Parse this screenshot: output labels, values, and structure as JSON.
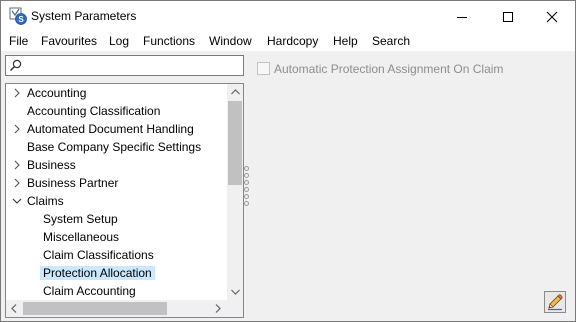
{
  "window": {
    "title": "System Parameters",
    "controls": {
      "minimize_icon": "minimize-icon",
      "maximize_icon": "maximize-icon",
      "close_icon": "close-icon"
    }
  },
  "menu": [
    "File",
    "Favourites",
    "Log",
    "Functions",
    "Window",
    "Hardcopy",
    "Help",
    "Search"
  ],
  "search": {
    "placeholder": "",
    "value": "",
    "icon": "search-icon"
  },
  "tree": {
    "items": [
      {
        "label": "Accounting",
        "level": 0,
        "state": "collapsed"
      },
      {
        "label": "Accounting Classification",
        "level": 0,
        "state": "none"
      },
      {
        "label": "Automated Document Handling",
        "level": 0,
        "state": "collapsed"
      },
      {
        "label": "Base Company Specific Settings",
        "level": 0,
        "state": "none"
      },
      {
        "label": "Business",
        "level": 0,
        "state": "collapsed"
      },
      {
        "label": "Business Partner",
        "level": 0,
        "state": "collapsed"
      },
      {
        "label": "Claims",
        "level": 0,
        "state": "expanded"
      },
      {
        "label": "System Setup",
        "level": 1,
        "state": "none"
      },
      {
        "label": "Miscellaneous",
        "level": 1,
        "state": "none"
      },
      {
        "label": "Claim Classifications",
        "level": 1,
        "state": "none"
      },
      {
        "label": "Protection Allocation",
        "level": 1,
        "state": "none",
        "selected": true
      },
      {
        "label": "Claim Accounting",
        "level": 1,
        "state": "none"
      }
    ]
  },
  "detail": {
    "checkbox_label": "Automatic Protection Assignment On Claim",
    "checkbox_checked": false,
    "checkbox_enabled": false
  },
  "edit_button_icon": "pencil-icon",
  "colors": {
    "selection": "#cce8ff",
    "disabled_text": "#8d8d8d",
    "window_bg": "#f0f0f0"
  }
}
